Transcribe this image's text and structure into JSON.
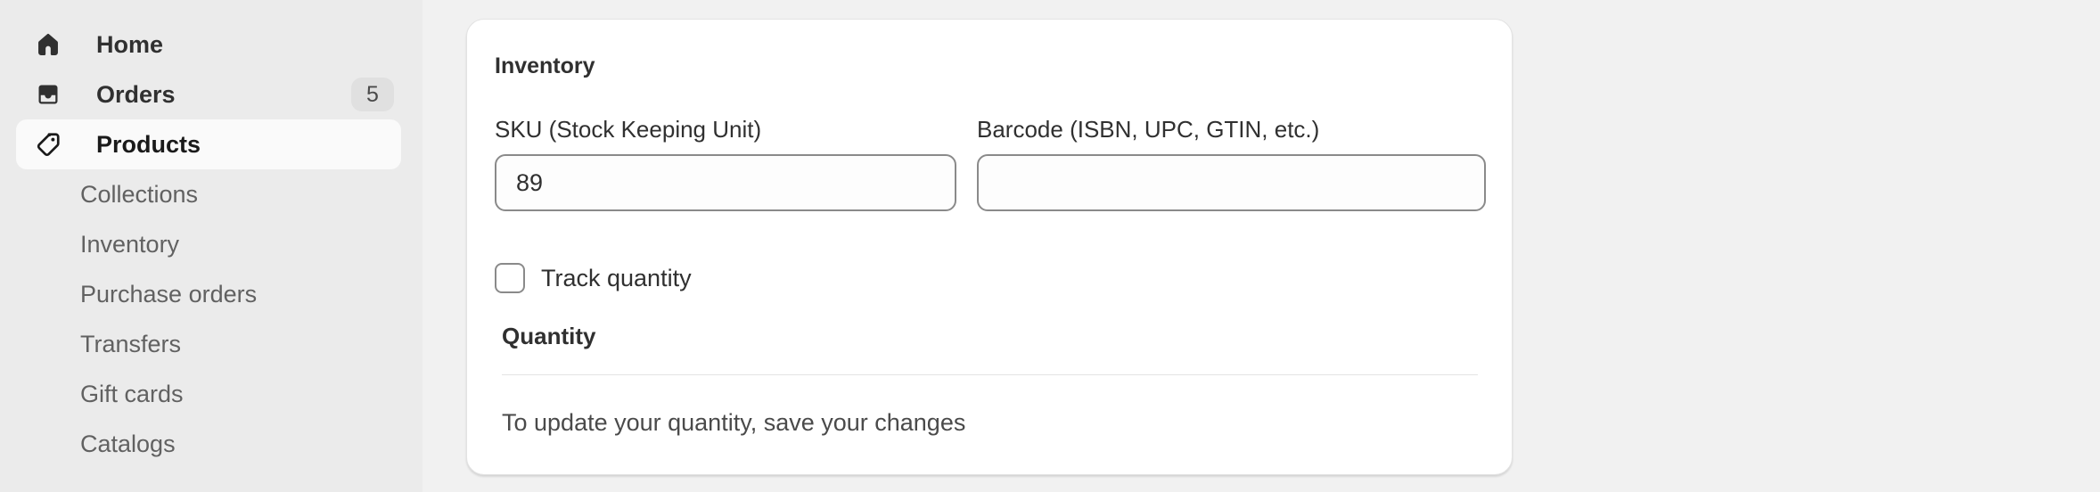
{
  "sidebar": {
    "items": [
      {
        "label": "Home",
        "icon": "home-icon"
      },
      {
        "label": "Orders",
        "icon": "inbox-icon",
        "badge": "5"
      },
      {
        "label": "Products",
        "icon": "tag-icon"
      }
    ],
    "subitems": [
      {
        "label": "Collections"
      },
      {
        "label": "Inventory"
      },
      {
        "label": "Purchase orders"
      },
      {
        "label": "Transfers"
      },
      {
        "label": "Gift cards"
      },
      {
        "label": "Catalogs"
      }
    ]
  },
  "inventory_card": {
    "title": "Inventory",
    "sku_label": "SKU (Stock Keeping Unit)",
    "sku_value": "89",
    "barcode_label": "Barcode (ISBN, UPC, GTIN, etc.)",
    "barcode_value": "",
    "track_quantity_label": "Track quantity",
    "track_quantity_checked": false,
    "quantity_title": "Quantity",
    "quantity_hint": "To update your quantity, save your changes"
  },
  "colors": {
    "sidebar_bg": "#ebebeb",
    "page_bg": "#f1f1f1",
    "active_item_bg": "#fafafa",
    "card_bg": "#ffffff"
  }
}
